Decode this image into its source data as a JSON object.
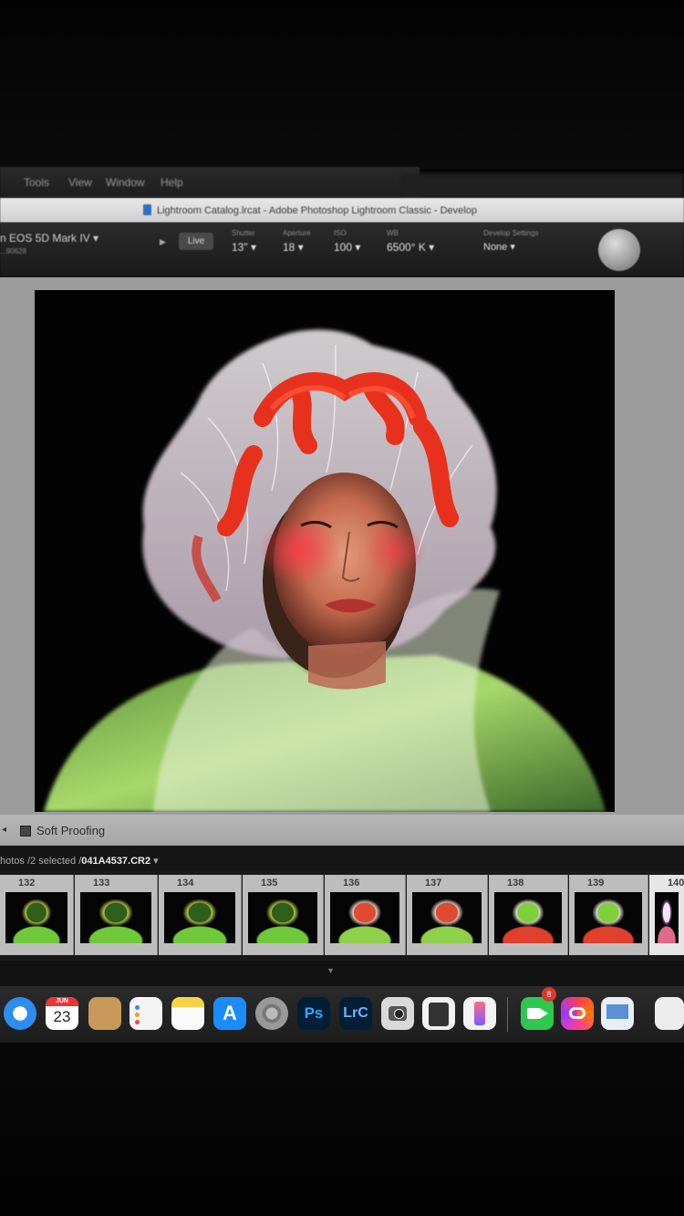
{
  "app": {
    "window_title": "Lightroom Catalog.lrcat - Adobe Photoshop Lightroom Classic - Develop",
    "menu": [
      "Tools",
      "View",
      "Window",
      "Help"
    ]
  },
  "toolbar": {
    "camera": "n EOS 5D Mark IV",
    "camera_sub": "...90628",
    "live_label": "Live",
    "shutter_label": "Shutter",
    "shutter_value": "13\"",
    "aperture_label": "Aperture",
    "aperture_value": "18",
    "iso_label": "ISO",
    "iso_value": "100",
    "wb_label": "WB",
    "wb_value": "6500° K",
    "develop_settings_label": "Develop Settings",
    "develop_settings_value": "None"
  },
  "soft_proofing": {
    "label": "Soft Proofing",
    "checked": false
  },
  "filmstrip": {
    "status_prefix": "hotos /2 selected /",
    "selected_file": "041A4537.CR2",
    "frames": [
      {
        "num": "132",
        "tone": "green"
      },
      {
        "num": "133",
        "tone": "green"
      },
      {
        "num": "134",
        "tone": "green"
      },
      {
        "num": "135",
        "tone": "green"
      },
      {
        "num": "136",
        "tone": "mixed"
      },
      {
        "num": "137",
        "tone": "mixed"
      },
      {
        "num": "138",
        "tone": "red"
      },
      {
        "num": "139",
        "tone": "red"
      },
      {
        "num": "140",
        "tone": "pink"
      }
    ]
  },
  "dock": {
    "calendar_month": "JUN",
    "calendar_day": "23",
    "ps_label": "Ps",
    "lrc_label": "LrC",
    "facetime_badge": "8",
    "items": [
      "safari-icon",
      "calendar-icon",
      "contacts-icon",
      "reminders-icon",
      "notes-icon",
      "app-store-icon",
      "system-settings-icon",
      "photoshop-icon",
      "lightroom-classic-icon",
      "photo-booth-icon",
      "calculator-icon",
      "iphone-mirroring-icon",
      "facetime-icon",
      "creative-cloud-icon",
      "preview-icon",
      "document-icon"
    ]
  },
  "colors": {
    "accent_red": "#e8311c",
    "lr_panel": "#1a1a1a",
    "ps_blue": "#31a8ff",
    "lrc_blue": "#6fb5ff"
  }
}
